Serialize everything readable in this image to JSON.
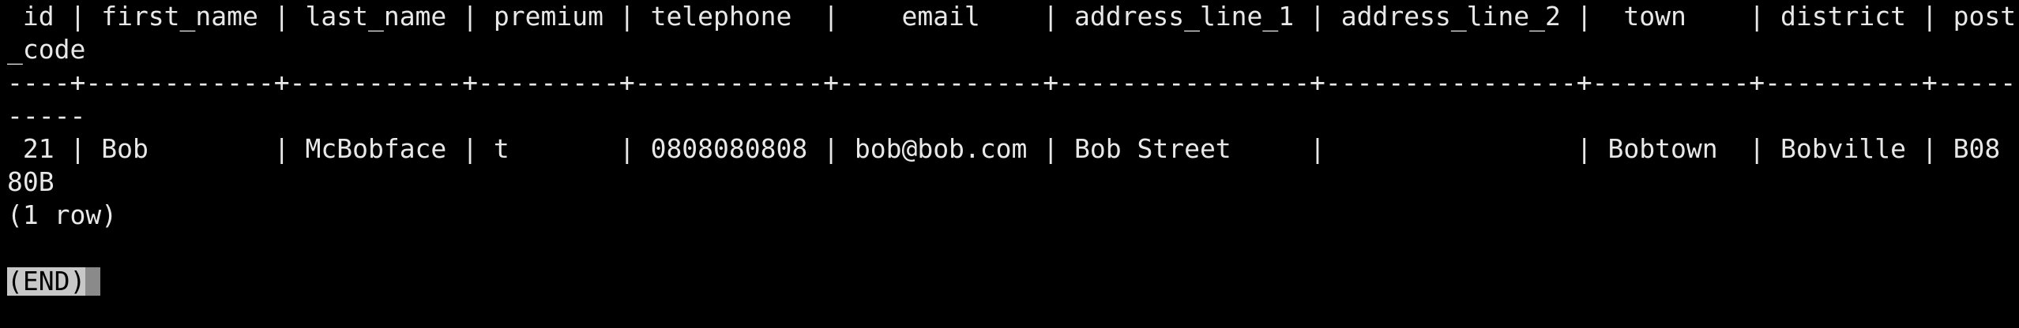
{
  "terminal": {
    "lines": [
      " id | first_name | last_name | premium | telephone  |    email    | address_line_1 | address_line_2 |  town    | district | post",
      "_code",
      "----+------------+-----------+---------+------------+-------------+----------------+----------------+----------+----------+-----",
      "-----",
      " 21 | Bob        | McBobface | t       | 0808080808 | bob@bob.com | Bob Street     |                | Bobtown  | Bobville | B08",
      "80B",
      "(1 row)"
    ],
    "end_marker": "(END)"
  },
  "colors": {
    "background": "#000000",
    "foreground": "#e8e8e8",
    "end_marker_background": "#c8c8c8",
    "cursor": "#8a8a8a"
  }
}
